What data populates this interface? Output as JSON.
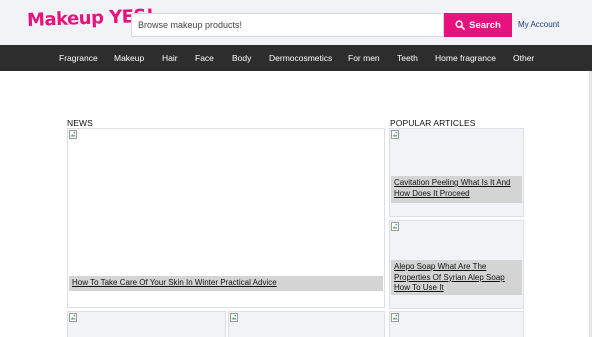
{
  "header": {
    "logo": "Makeup YES!",
    "search": {
      "placeholder": "Browse makeup products!",
      "value": ""
    },
    "search_button": "Search",
    "account_link": "My Account"
  },
  "nav": {
    "items": [
      "Fragrance",
      "Makeup",
      "Hair",
      "Face",
      "Body",
      "Dermocosmetics",
      "For men",
      "Teeth",
      "Home fragrance",
      "Other"
    ]
  },
  "news": {
    "label": "NEWS",
    "main_article": "How To Take Care Of Your Skin In Winter Practical Advice"
  },
  "popular": {
    "label": "POPULAR ARTICLES",
    "articles": [
      "Cavitation Peeling What Is It And How Does It Proceed",
      "Alepo Soap What Are The Properties Of Syrian Alep Soap How To Use It"
    ]
  },
  "colors": {
    "brand": "#e6127d",
    "nav_bg": "#2d2d2d",
    "header_bg": "#f1f3f7",
    "caption_bg": "#d4d4d4"
  }
}
